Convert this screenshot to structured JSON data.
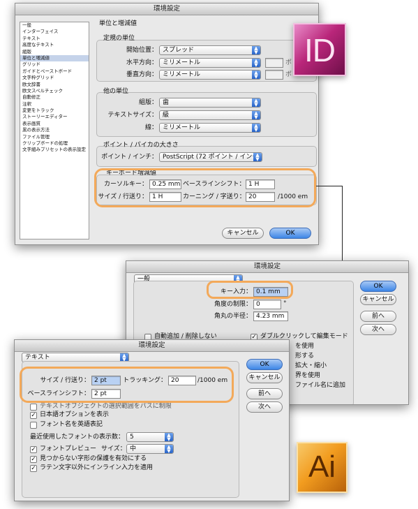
{
  "indesign": {
    "title": "環境設定",
    "logo_text": "ID",
    "sidebar": [
      "一般",
      "インターフェイス",
      "テキスト",
      "高度なテキスト",
      "組版",
      "単位と増減値",
      "グリッド",
      "ガイドとペーストボード",
      "文字枠グリッド",
      "欧文辞書",
      "欧文スペルチェック",
      "自動修正",
      "注釈",
      "変更をトラック",
      "ストーリーエディター",
      "表示画質",
      "黒の表示方法",
      "ファイル管理",
      "クリップボードの処理",
      "文字組みプリセットの表示設定"
    ],
    "sidebar_active": 5,
    "section_title": "単位と増減値",
    "units": {
      "title": "定規の単位",
      "origin_label": "開始位置：",
      "origin_value": "スプレッド",
      "h_label": "水平方向：",
      "h_value": "ミリメートル",
      "v_label": "垂直方向：",
      "v_value": "ミリメートル",
      "side_text_1": "ポ",
      "side_text_2": "ポ"
    },
    "other_units": {
      "title": "他の単位",
      "comp_label": "組版：",
      "comp_value": "歯",
      "textsize_label": "テキストサイズ：",
      "textsize_value": "級",
      "line_label": "線：",
      "line_value": "ミリメートル"
    },
    "points": {
      "title": "ポイント / パイカの大きさ",
      "label": "ポイント / インチ：",
      "value": "PostScript (72 ポイント / インチ)"
    },
    "keyboard": {
      "title": "キーボード増減値",
      "cursor_label": "カーソルキー：",
      "cursor_value": "0.25 mm",
      "baseline_label": "ベースラインシフト：",
      "baseline_value": "1 H",
      "size_label": "サイズ / 行送り：",
      "size_value": "1 H",
      "kern_label": "カーニング / 字送り：",
      "kern_value": "20",
      "kern_unit": "/1000 em"
    },
    "cancel": "キャンセル",
    "ok": "OK"
  },
  "illustrator_general": {
    "title": "環境設定",
    "panel": "一般",
    "key_label": "キー入力：",
    "key_value": "0.1 mm",
    "angle_label": "角度の制限：",
    "angle_value": "0",
    "angle_unit": "°",
    "radius_label": "角丸の半径：",
    "radius_value": "4.23 mm",
    "cb1": "自動追加 / 削除しない",
    "cb2": "ダブルクリックして編集モード",
    "peek": [
      "を使用",
      "形する",
      "拡大・縮小",
      "界を使用",
      "ファイル名に追加"
    ],
    "ok": "OK",
    "cancel": "キャンセル",
    "prev": "前へ",
    "next": "次へ"
  },
  "illustrator_text": {
    "title": "環境設定",
    "panel": "テキスト",
    "size_label": "サイズ / 行送り：",
    "size_value": "2 pt",
    "tracking_label": "トラッキング：",
    "tracking_value": "20",
    "tracking_unit": "/1000 em",
    "baseline_label": "ベースラインシフト：",
    "baseline_value": "2 pt",
    "cb_hidden": "テキストオブジェクトの選択範囲をパスに制限",
    "cb_japanese": "日本語オプションを表示",
    "cb_fontname": "フォント名を英語表記",
    "recent_label": "最近使用したフォントの表示数：",
    "recent_value": "5",
    "preview_label": "フォントプレビュー",
    "preview_size_label": "サイズ：",
    "preview_size_value": "中",
    "cb_missing": "見つからない字形の保護を有効にする",
    "cb_inline": "ラテン文字以外にインライン入力を適用",
    "ok": "OK",
    "cancel": "キャンセル",
    "prev": "前へ",
    "next": "次へ",
    "logo_text": "Ai"
  },
  "colors": {
    "highlight": "#f3a95a",
    "id_logo": "#b9267a",
    "ai_logo": "#f29c1f",
    "ok_button": "#3d86e6"
  }
}
